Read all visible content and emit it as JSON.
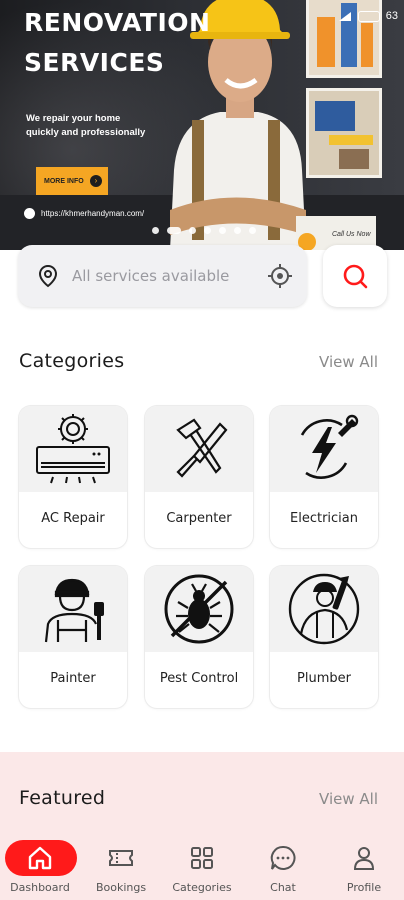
{
  "hero": {
    "title_line1": "RENOVATION",
    "title_line2": "SERVICES",
    "subtitle_line1": "We repair your home",
    "subtitle_line2": "quickly and professionally",
    "more_info_label": "MORE INFO",
    "url": "https://khmerhandyman.com/",
    "call_label_line1": "Call Us Now",
    "call_label_line2": "",
    "slides_count": 7,
    "active_slide": 1,
    "accent_color": "#f5a623"
  },
  "status_bar": {
    "battery": "63"
  },
  "search": {
    "placeholder": "All services available"
  },
  "categories": {
    "title": "Categories",
    "view_all": "View All",
    "items": [
      {
        "label": "AC Repair",
        "icon": "ac-repair-icon"
      },
      {
        "label": "Carpenter",
        "icon": "carpenter-tools-icon"
      },
      {
        "label": "Electrician",
        "icon": "electrician-icon"
      },
      {
        "label": "Painter",
        "icon": "painter-icon"
      },
      {
        "label": "Pest Control",
        "icon": "pest-control-icon"
      },
      {
        "label": "Plumber",
        "icon": "plumber-icon"
      }
    ]
  },
  "featured": {
    "title": "Featured",
    "view_all": "View All"
  },
  "bottom_nav": {
    "active": "Dashboard",
    "active_color": "#ff1a1a",
    "items": [
      {
        "label": "Dashboard",
        "icon": "home-icon"
      },
      {
        "label": "Bookings",
        "icon": "ticket-icon"
      },
      {
        "label": "Categories",
        "icon": "grid-icon"
      },
      {
        "label": "Chat",
        "icon": "chat-icon"
      },
      {
        "label": "Profile",
        "icon": "user-icon"
      }
    ]
  }
}
